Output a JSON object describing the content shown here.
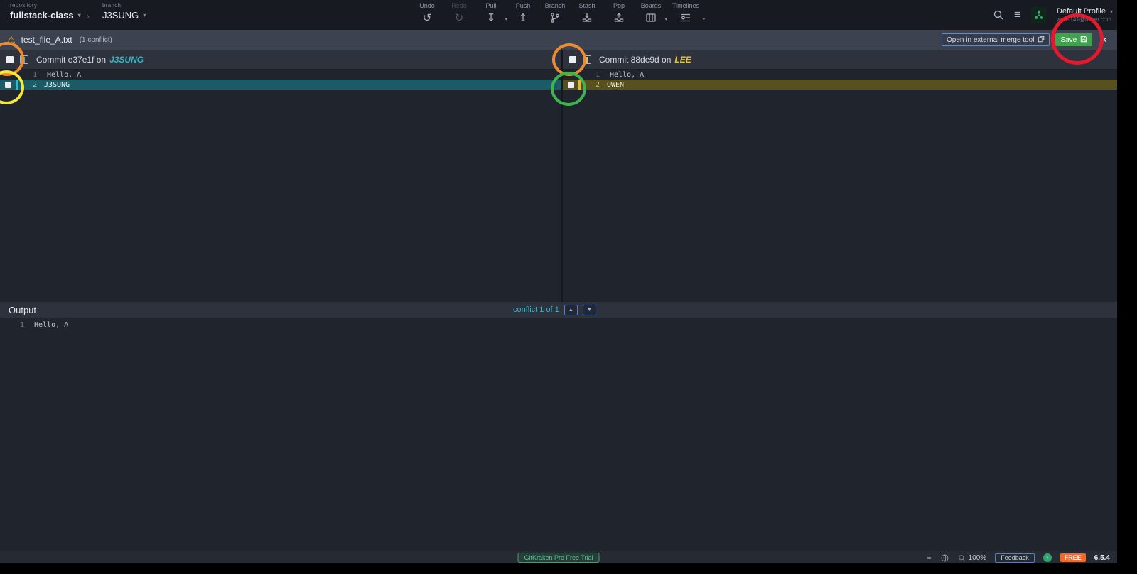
{
  "topbar": {
    "repository": {
      "label": "repository",
      "name": "fullstack-class"
    },
    "branch": {
      "label": "branch",
      "name": "J3SUNG"
    },
    "actions": [
      "Undo",
      "Redo",
      "Pull",
      "Push",
      "Branch",
      "Stash",
      "Pop",
      "Boards",
      "Timelines"
    ],
    "profile": {
      "name": "Default Profile",
      "email": "wens141@naver.com"
    }
  },
  "conflict_bar": {
    "filename": "test_file_A.txt",
    "conflict_count": "(1 conflict)",
    "external_tool_label": "Open in external merge tool",
    "save_label": "Save"
  },
  "merge": {
    "left": {
      "commit_label": "Commit e37e1f on",
      "ref": "J3SUNG",
      "lines": [
        {
          "num": "1",
          "text": "Hello, A"
        },
        {
          "num": "2",
          "text": "J3SUNG"
        }
      ]
    },
    "right": {
      "commit_label": "Commit 88de9d on",
      "ref": "LEE",
      "lines": [
        {
          "num": "1",
          "text": "Hello, A"
        },
        {
          "num": "2",
          "text": "OWEN"
        }
      ]
    }
  },
  "output": {
    "title": "Output",
    "conflict_nav": "conflict 1 of 1",
    "lines": [
      {
        "num": "1",
        "text": "Hello, A"
      }
    ]
  },
  "statusbar": {
    "trial_label": "GitKraken Pro Free Trial",
    "zoom": "100%",
    "feedback_label": "Feedback",
    "plan_badge": "FREE",
    "version": "6.5.4"
  },
  "colors": {
    "accent_cyan": "#35b6c9",
    "accent_yellow": "#e8c341",
    "save_green": "#3fa24c",
    "badge_orange": "#f26a2a",
    "left_conflict_bg": "#1a5b66",
    "right_conflict_bg": "#57501f",
    "annotation_red": "#e3192d",
    "annotation_orange": "#ee8a2f",
    "annotation_yellow": "#f2e73c",
    "annotation_green": "#3cb54f"
  }
}
